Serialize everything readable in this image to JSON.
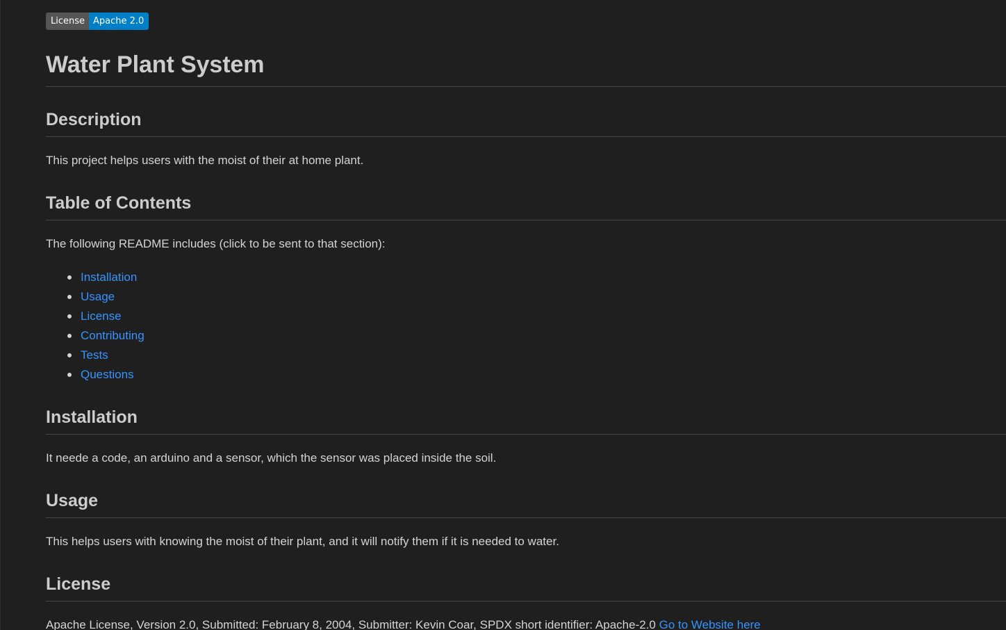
{
  "badge": {
    "label": "License",
    "value": "Apache 2.0",
    "value_color": "#007ec6"
  },
  "title": "Water Plant System",
  "sections": {
    "description": {
      "heading": "Description",
      "text": "This project helps users with the moist of their at home plant."
    },
    "toc": {
      "heading": "Table of Contents",
      "intro": "The following README includes (click to be sent to that section):",
      "items": [
        {
          "label": "Installation"
        },
        {
          "label": "Usage"
        },
        {
          "label": "License"
        },
        {
          "label": "Contributing"
        },
        {
          "label": "Tests"
        },
        {
          "label": "Questions"
        }
      ]
    },
    "installation": {
      "heading": "Installation",
      "text": "It neede a code, an arduino and a sensor, which the sensor was placed inside the soil."
    },
    "usage": {
      "heading": "Usage",
      "text": "This helps users with knowing the moist of their plant, and it will notify them if it is needed to water."
    },
    "license": {
      "heading": "License",
      "text": "Apache License, Version 2.0, Submitted: February 8, 2004, Submitter: Kevin Coar, SPDX short identifier: Apache-2.0",
      "link_label": "Go to Website here"
    }
  },
  "colors": {
    "background": "#1f1f1f",
    "text": "#d4d4d4",
    "heading": "#cccccc",
    "link": "#3794ff",
    "rule": "#444444"
  }
}
